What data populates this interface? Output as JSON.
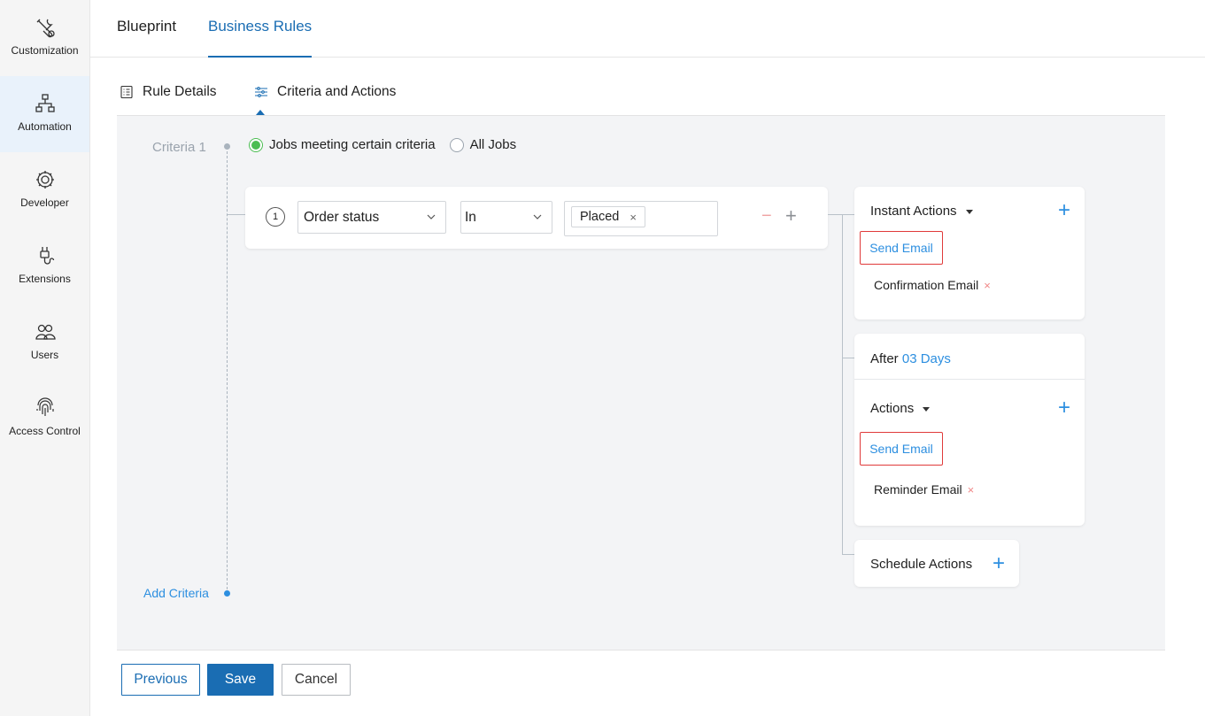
{
  "sidebar": {
    "items": [
      {
        "label": "Customization",
        "icon": "tools-icon"
      },
      {
        "label": "Automation",
        "icon": "flow-icon"
      },
      {
        "label": "Developer",
        "icon": "gear-icon"
      },
      {
        "label": "Extensions",
        "icon": "plug-icon"
      },
      {
        "label": "Users",
        "icon": "users-icon"
      },
      {
        "label": "Access Control",
        "icon": "fingerprint-icon"
      }
    ],
    "active": "Automation"
  },
  "top_tabs": [
    "Blueprint",
    "Business Rules"
  ],
  "sub_tabs": [
    "Rule Details",
    "Criteria and Actions"
  ],
  "criteria": {
    "label": "Criteria 1",
    "options": [
      "Jobs meeting certain criteria",
      "All Jobs"
    ],
    "selected": "Jobs meeting certain criteria",
    "add_label": "Add Criteria",
    "condition": {
      "number": "1",
      "field": "Order status",
      "operator": "In",
      "value": "Placed",
      "remove_symbol": "×",
      "minus_symbol": "−",
      "plus_symbol": "+"
    }
  },
  "instant_actions": {
    "title": "Instant Actions",
    "action_label": "Send Email",
    "email": "Confirmation Email"
  },
  "delayed_actions": {
    "after_prefix": "After",
    "after_value": "03 Days",
    "title": "Actions",
    "action_label": "Send Email",
    "email": "Reminder Email"
  },
  "schedule_actions": {
    "title": "Schedule Actions"
  },
  "footer": {
    "previous": "Previous",
    "save": "Save",
    "cancel": "Cancel"
  },
  "colors": {
    "accent": "#1a6db3",
    "link": "#2d8fe0",
    "highlight_border": "#e03a3a",
    "radio_checked": "#4bbd52"
  }
}
